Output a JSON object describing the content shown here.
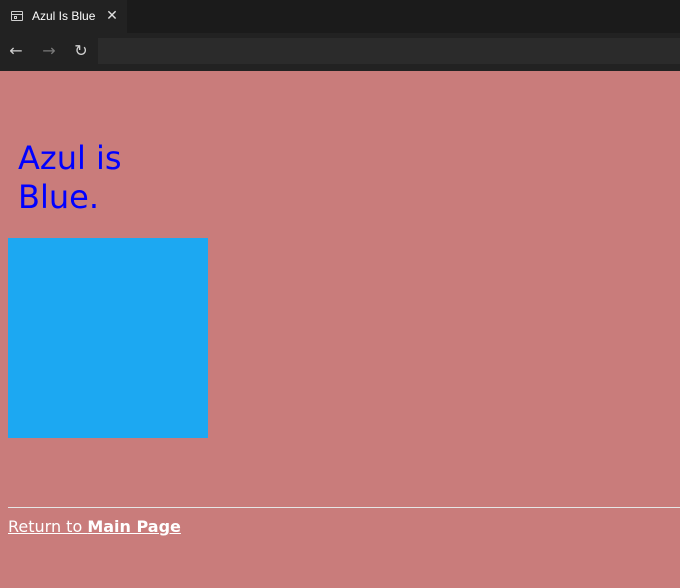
{
  "tab": {
    "title": "Azul Is Blue",
    "page_icon": "page-icon",
    "close_icon": "close-icon",
    "close_glyph": "✕"
  },
  "nav": {
    "back_glyph": "←",
    "forward_glyph": "→",
    "reload_glyph": "↻",
    "address_value": ""
  },
  "page": {
    "heading": "Azul is Blue.",
    "heading_color": "#0000ff",
    "background_color": "#c97c7b",
    "square_color": "#1ca8f2",
    "link_prefix": "Return to ",
    "link_bold": "Main Page",
    "link_color": "#ffffff"
  }
}
